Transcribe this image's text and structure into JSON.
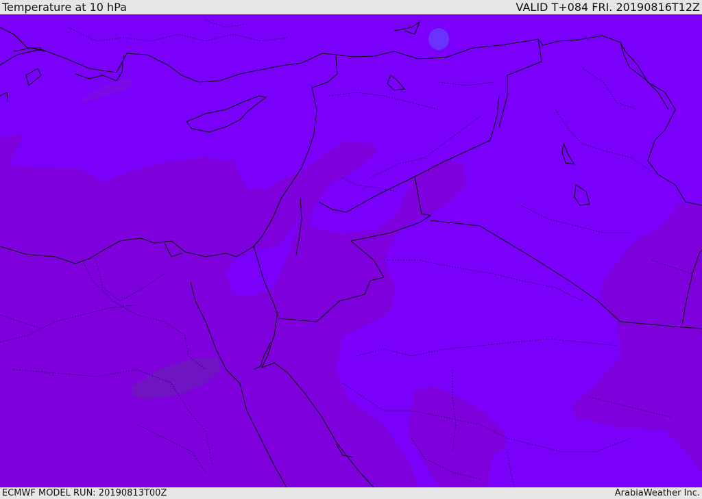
{
  "header": {
    "title": "Temperature at 10 hPa",
    "valid": "VALID T+084 FRI. 20190816T12Z"
  },
  "footer": {
    "model_run": "ECMWF MODEL RUN: 20190813T00Z",
    "credit": "ArabiaWeather Inc."
  },
  "map": {
    "field": "temperature",
    "level": "10 hPa",
    "colors": {
      "light_violet": "#7a00fb",
      "dark_violet": "#7d00dd",
      "blue_spot": "#6a32fd",
      "brown_spot": "#6f14c2",
      "coastline": "#000000",
      "border": "#000000"
    }
  }
}
